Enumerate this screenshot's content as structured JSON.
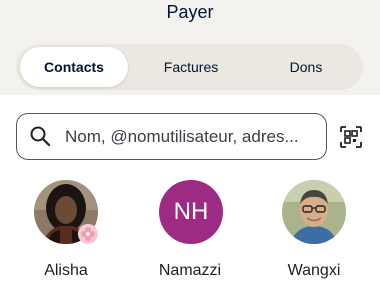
{
  "header": {
    "title": "Payer"
  },
  "tabs": [
    {
      "label": "Contacts",
      "active": true
    },
    {
      "label": "Factures",
      "active": false
    },
    {
      "label": "Dons",
      "active": false
    }
  ],
  "search": {
    "placeholder": "Nom, @nomutilisateur, adres...",
    "icon": "search-icon"
  },
  "scan": {
    "icon": "qr-scan-icon"
  },
  "contacts": [
    {
      "name": "Alisha",
      "avatar": "photo",
      "badge": "flower-icon"
    },
    {
      "name": "Namazzi",
      "initials": "NH",
      "avatar_color": "#9d2b84"
    },
    {
      "name": "Wangxi",
      "avatar": "photo"
    }
  ],
  "colors": {
    "header_bg": "#f4f2ee",
    "tabs_bg": "#ebe8e2",
    "text_primary": "#001435",
    "initials_avatar": "#9d2b84"
  }
}
